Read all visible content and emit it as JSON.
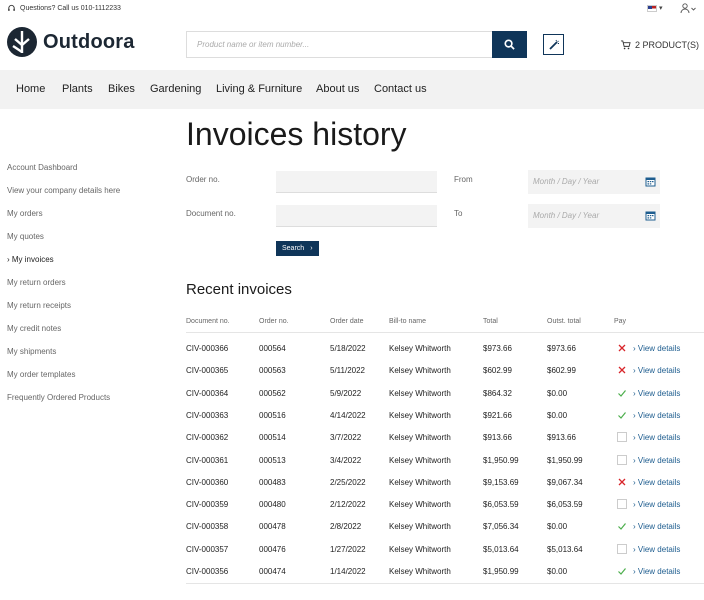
{
  "topbar": {
    "questions": "Questions? Call us 010-1112233"
  },
  "brand": {
    "name": "Outdoora"
  },
  "search": {
    "placeholder": "Product name or item number..."
  },
  "cart": {
    "label": "2 PRODUCT(S)"
  },
  "nav": [
    "Home",
    "Plants",
    "Bikes",
    "Gardening",
    "Living & Furniture",
    "About us",
    "Contact us"
  ],
  "sidebar": [
    {
      "label": "Account Dashboard",
      "active": false
    },
    {
      "label": "View your company details here",
      "active": false
    },
    {
      "label": "My orders",
      "active": false
    },
    {
      "label": "My quotes",
      "active": false
    },
    {
      "label": "› My invoices",
      "active": true
    },
    {
      "label": "My return orders",
      "active": false
    },
    {
      "label": "My return receipts",
      "active": false
    },
    {
      "label": "My credit notes",
      "active": false
    },
    {
      "label": "My shipments",
      "active": false
    },
    {
      "label": "My order templates",
      "active": false
    },
    {
      "label": "Frequently Ordered Products",
      "active": false
    }
  ],
  "page": {
    "title": "Invoices history"
  },
  "filters": {
    "order_no_label": "Order no.",
    "document_no_label": "Document no.",
    "from_label": "From",
    "to_label": "To",
    "date_placeholder": "Month / Day / Year",
    "search_button": "Search"
  },
  "recent": {
    "title": "Recent invoices",
    "columns": [
      "Document no.",
      "Order no.",
      "Order date",
      "Bill-to name",
      "Total",
      "Outst. total",
      "Pay"
    ],
    "view_label": "› View details",
    "rows": [
      {
        "doc": "CIV-000366",
        "order": "000564",
        "date": "5/18/2022",
        "name": "Kelsey Whitworth",
        "total": "$973.66",
        "outst": "$973.66",
        "pay": "cross"
      },
      {
        "doc": "CIV-000365",
        "order": "000563",
        "date": "5/11/2022",
        "name": "Kelsey Whitworth",
        "total": "$602.99",
        "outst": "$602.99",
        "pay": "cross"
      },
      {
        "doc": "CIV-000364",
        "order": "000562",
        "date": "5/9/2022",
        "name": "Kelsey Whitworth",
        "total": "$864.32",
        "outst": "$0.00",
        "pay": "check"
      },
      {
        "doc": "CIV-000363",
        "order": "000516",
        "date": "4/14/2022",
        "name": "Kelsey Whitworth",
        "total": "$921.66",
        "outst": "$0.00",
        "pay": "check"
      },
      {
        "doc": "CIV-000362",
        "order": "000514",
        "date": "3/7/2022",
        "name": "Kelsey Whitworth",
        "total": "$913.66",
        "outst": "$913.66",
        "pay": "box"
      },
      {
        "doc": "CIV-000361",
        "order": "000513",
        "date": "3/4/2022",
        "name": "Kelsey Whitworth",
        "total": "$1,950.99",
        "outst": "$1,950.99",
        "pay": "box"
      },
      {
        "doc": "CIV-000360",
        "order": "000483",
        "date": "2/25/2022",
        "name": "Kelsey Whitworth",
        "total": "$9,153.69",
        "outst": "$9,067.34",
        "pay": "cross"
      },
      {
        "doc": "CIV-000359",
        "order": "000480",
        "date": "2/12/2022",
        "name": "Kelsey Whitworth",
        "total": "$6,053.59",
        "outst": "$6,053.59",
        "pay": "box"
      },
      {
        "doc": "CIV-000358",
        "order": "000478",
        "date": "2/8/2022",
        "name": "Kelsey Whitworth",
        "total": "$7,056.34",
        "outst": "$0.00",
        "pay": "check"
      },
      {
        "doc": "CIV-000357",
        "order": "000476",
        "date": "1/27/2022",
        "name": "Kelsey Whitworth",
        "total": "$5,013.64",
        "outst": "$5,013.64",
        "pay": "box"
      },
      {
        "doc": "CIV-000356",
        "order": "000474",
        "date": "1/14/2022",
        "name": "Kelsey Whitworth",
        "total": "$1,950.99",
        "outst": "$0.00",
        "pay": "check"
      }
    ]
  },
  "colors": {
    "primary": "#0f3559",
    "cross": "#d8262b",
    "check": "#4cae4c",
    "link": "#1e5d8f"
  }
}
